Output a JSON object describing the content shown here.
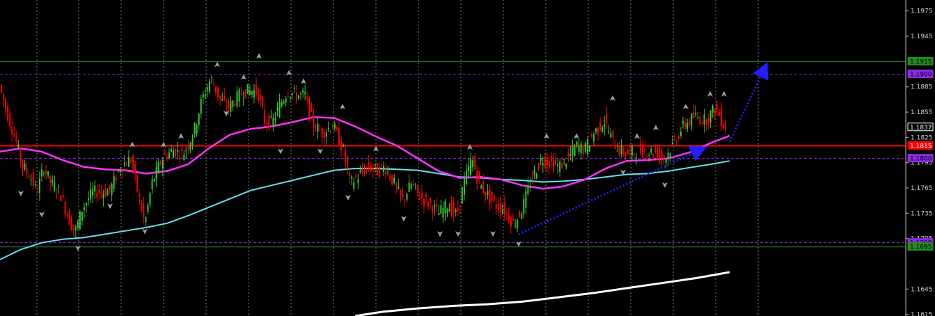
{
  "chart_data": {
    "type": "candlestick",
    "colors": {
      "background": "#000000",
      "grid": "#a6a6a6",
      "bull": "#32cd32",
      "bear": "#ff0000",
      "ma_magenta": "#ff33ff",
      "ma_cyan": "#66e0f0",
      "ma_white": "#ffffff",
      "fractal": "#a0a0a0",
      "trend_arrow": "#2020ff",
      "axis_text": "#d0d0d0"
    },
    "ylim": [
      1.1613,
      1.1988
    ],
    "y_ticks": [
      "1.1975",
      "1.1945",
      "1.1885",
      "1.1855",
      "1.1825",
      "1.1795",
      "1.1765",
      "1.1735",
      "1.1705",
      "1.1645",
      "1.1615"
    ],
    "y_tick_values": [
      1.1975,
      1.1945,
      1.1885,
      1.1855,
      1.1825,
      1.1795,
      1.1765,
      1.1735,
      1.1705,
      1.1645,
      1.1615
    ],
    "price_markers": [
      {
        "label": "1.1915",
        "value": 1.1915,
        "bg": "#228b22",
        "fg": "#000000"
      },
      {
        "label": "1.1900",
        "value": 1.19,
        "bg": "#8a2be2",
        "fg": "#000000"
      },
      {
        "label": "1.1837",
        "value": 1.1837,
        "bg": "#000000",
        "fg": "#ffffff"
      },
      {
        "label": "1.1815",
        "value": 1.1815,
        "bg": "#ff0000",
        "fg": "#ffffff"
      },
      {
        "label": "1.1800",
        "value": 1.18,
        "bg": "#8a2be2",
        "fg": "#000000"
      },
      {
        "label": "1.1700",
        "value": 1.17,
        "bg": "#8a2be2",
        "fg": "#000000"
      },
      {
        "label": "1.1695",
        "value": 1.1695,
        "bg": "#228b22",
        "fg": "#000000"
      }
    ],
    "horizontal_levels": [
      {
        "value": 1.1915,
        "style": "solid",
        "color": "#228b22"
      },
      {
        "value": 1.19,
        "style": "dash",
        "color": "#8a2be2"
      },
      {
        "value": 1.1815,
        "style": "solid",
        "color": "#ff0000",
        "width": 2
      },
      {
        "value": 1.18,
        "style": "dash",
        "color": "#8a2be2"
      },
      {
        "value": 1.17,
        "style": "dash",
        "color": "#8a2be2"
      },
      {
        "value": 1.1695,
        "style": "solid",
        "color": "#228b22"
      }
    ],
    "price_path": [
      [
        0,
        1.189
      ],
      [
        10,
        1.186
      ],
      [
        25,
        1.182
      ],
      [
        35,
        1.179
      ],
      [
        45,
        1.178
      ],
      [
        55,
        1.176
      ],
      [
        65,
        1.179
      ],
      [
        75,
        1.177
      ],
      [
        88,
        1.176
      ],
      [
        100,
        1.173
      ],
      [
        110,
        1.1712
      ],
      [
        120,
        1.174
      ],
      [
        135,
        1.176
      ],
      [
        150,
        1.176
      ],
      [
        160,
        1.1762
      ],
      [
        175,
        1.179
      ],
      [
        190,
        1.18
      ],
      [
        200,
        1.176
      ],
      [
        210,
        1.1722
      ],
      [
        220,
        1.177
      ],
      [
        235,
        1.18
      ],
      [
        250,
        1.181
      ],
      [
        265,
        1.1805
      ],
      [
        280,
        1.183
      ],
      [
        292,
        1.187
      ],
      [
        305,
        1.1895
      ],
      [
        318,
        1.187
      ],
      [
        330,
        1.186
      ],
      [
        340,
        1.187
      ],
      [
        352,
        1.188
      ],
      [
        362,
        1.188
      ],
      [
        372,
        1.188
      ],
      [
        382,
        1.1845
      ],
      [
        393,
        1.1842
      ],
      [
        405,
        1.1865
      ],
      [
        415,
        1.188
      ],
      [
        428,
        1.1875
      ],
      [
        440,
        1.1875
      ],
      [
        452,
        1.184
      ],
      [
        465,
        1.183
      ],
      [
        480,
        1.184
      ],
      [
        495,
        1.181
      ],
      [
        505,
        1.177
      ],
      [
        518,
        1.178
      ],
      [
        530,
        1.179
      ],
      [
        545,
        1.1785
      ],
      [
        555,
        1.179
      ],
      [
        568,
        1.177
      ],
      [
        580,
        1.175
      ],
      [
        593,
        1.177
      ],
      [
        605,
        1.1755
      ],
      [
        620,
        1.1745
      ],
      [
        632,
        1.1735
      ],
      [
        645,
        1.1745
      ],
      [
        658,
        1.1732
      ],
      [
        668,
        1.177
      ],
      [
        680,
        1.18
      ],
      [
        690,
        1.177
      ],
      [
        700,
        1.176
      ],
      [
        712,
        1.1745
      ],
      [
        725,
        1.174
      ],
      [
        740,
        1.1722
      ],
      [
        752,
        1.174
      ],
      [
        765,
        1.1775
      ],
      [
        780,
        1.18
      ],
      [
        792,
        1.1795
      ],
      [
        805,
        1.179
      ],
      [
        818,
        1.18
      ],
      [
        830,
        1.1815
      ],
      [
        842,
        1.181
      ],
      [
        855,
        1.183
      ],
      [
        870,
        1.1845
      ],
      [
        882,
        1.182
      ],
      [
        892,
        1.181
      ],
      [
        905,
        1.1805
      ],
      [
        918,
        1.181
      ],
      [
        932,
        1.1808
      ],
      [
        945,
        1.1808
      ],
      [
        958,
        1.18
      ],
      [
        970,
        1.182
      ],
      [
        985,
        1.184
      ],
      [
        1000,
        1.185
      ],
      [
        1015,
        1.1845
      ],
      [
        1030,
        1.186
      ],
      [
        1043,
        1.1837
      ]
    ],
    "ma_magenta": [
      [
        0,
        1.1808
      ],
      [
        30,
        1.1812
      ],
      [
        60,
        1.1808
      ],
      [
        90,
        1.1798
      ],
      [
        120,
        1.179
      ],
      [
        150,
        1.1787
      ],
      [
        180,
        1.1786
      ],
      [
        210,
        1.1782
      ],
      [
        240,
        1.1785
      ],
      [
        270,
        1.1793
      ],
      [
        300,
        1.1812
      ],
      [
        330,
        1.1828
      ],
      [
        360,
        1.1835
      ],
      [
        390,
        1.1838
      ],
      [
        420,
        1.1843
      ],
      [
        450,
        1.1849
      ],
      [
        480,
        1.1848
      ],
      [
        510,
        1.1838
      ],
      [
        540,
        1.1826
      ],
      [
        570,
        1.1815
      ],
      [
        600,
        1.18
      ],
      [
        630,
        1.1785
      ],
      [
        660,
        1.1777
      ],
      [
        690,
        1.1778
      ],
      [
        720,
        1.1775
      ],
      [
        750,
        1.1768
      ],
      [
        780,
        1.1764
      ],
      [
        810,
        1.1767
      ],
      [
        840,
        1.1775
      ],
      [
        870,
        1.1788
      ],
      [
        900,
        1.1797
      ],
      [
        930,
        1.1798
      ],
      [
        960,
        1.18
      ],
      [
        990,
        1.1807
      ],
      [
        1020,
        1.1818
      ],
      [
        1048,
        1.1827
      ]
    ],
    "ma_cyan": [
      [
        0,
        1.168
      ],
      [
        30,
        1.1692
      ],
      [
        60,
        1.17
      ],
      [
        90,
        1.1704
      ],
      [
        120,
        1.1706
      ],
      [
        150,
        1.171
      ],
      [
        180,
        1.1714
      ],
      [
        210,
        1.1718
      ],
      [
        240,
        1.1723
      ],
      [
        270,
        1.1732
      ],
      [
        300,
        1.1742
      ],
      [
        330,
        1.1752
      ],
      [
        360,
        1.1762
      ],
      [
        390,
        1.1768
      ],
      [
        420,
        1.1774
      ],
      [
        450,
        1.178
      ],
      [
        480,
        1.1786
      ],
      [
        510,
        1.1788
      ],
      [
        540,
        1.1788
      ],
      [
        570,
        1.1787
      ],
      [
        600,
        1.1786
      ],
      [
        630,
        1.1782
      ],
      [
        660,
        1.1778
      ],
      [
        690,
        1.1777
      ],
      [
        720,
        1.1775
      ],
      [
        750,
        1.1774
      ],
      [
        780,
        1.1772
      ],
      [
        810,
        1.1773
      ],
      [
        840,
        1.1775
      ],
      [
        870,
        1.1778
      ],
      [
        900,
        1.1781
      ],
      [
        930,
        1.1782
      ],
      [
        960,
        1.1785
      ],
      [
        990,
        1.1789
      ],
      [
        1020,
        1.1793
      ],
      [
        1048,
        1.1797
      ]
    ],
    "ma_white": [
      [
        510,
        1.1613
      ],
      [
        550,
        1.1618
      ],
      [
        600,
        1.1622
      ],
      [
        650,
        1.1625
      ],
      [
        700,
        1.1627
      ],
      [
        750,
        1.163
      ],
      [
        800,
        1.1635
      ],
      [
        850,
        1.164
      ],
      [
        900,
        1.1646
      ],
      [
        950,
        1.1652
      ],
      [
        1000,
        1.1658
      ],
      [
        1048,
        1.1665
      ]
    ],
    "trend_arrows": [
      {
        "from": [
          745,
          1.171
        ],
        "to": [
          1010,
          1.1812
        ]
      },
      {
        "from": [
          1048,
          1.182
        ],
        "to": [
          1100,
          1.191
        ]
      }
    ],
    "fractals_up": [
      [
        312,
        1.191
      ],
      [
        372,
        1.192
      ],
      [
        415,
        1.19
      ],
      [
        436,
        1.189
      ],
      [
        492,
        1.186
      ],
      [
        540,
        1.181
      ],
      [
        675,
        1.1812
      ],
      [
        785,
        1.1825
      ],
      [
        828,
        1.1825
      ],
      [
        880,
        1.187
      ],
      [
        915,
        1.1825
      ],
      [
        942,
        1.1835
      ],
      [
        985,
        1.186
      ],
      [
        1020,
        1.1875
      ],
      [
        1040,
        1.1875
      ],
      [
        190,
        1.1815
      ],
      [
        235,
        1.1815
      ],
      [
        260,
        1.1825
      ],
      [
        350,
        1.1895
      ]
    ],
    "fractals_down": [
      [
        30,
        1.176
      ],
      [
        60,
        1.1735
      ],
      [
        112,
        1.1695
      ],
      [
        208,
        1.1715
      ],
      [
        325,
        1.1855
      ],
      [
        403,
        1.181
      ],
      [
        460,
        1.181
      ],
      [
        500,
        1.1755
      ],
      [
        580,
        1.173
      ],
      [
        632,
        1.1712
      ],
      [
        658,
        1.1712
      ],
      [
        708,
        1.1712
      ],
      [
        745,
        1.17
      ],
      [
        895,
        1.1785
      ],
      [
        955,
        1.177
      ],
      [
        158,
        1.1745
      ]
    ],
    "vgrid_x": [
      53,
      113,
      174,
      235,
      296,
      357,
      418,
      479,
      540,
      601,
      662,
      723,
      784,
      845,
      906,
      967,
      1028,
      1089
    ]
  }
}
